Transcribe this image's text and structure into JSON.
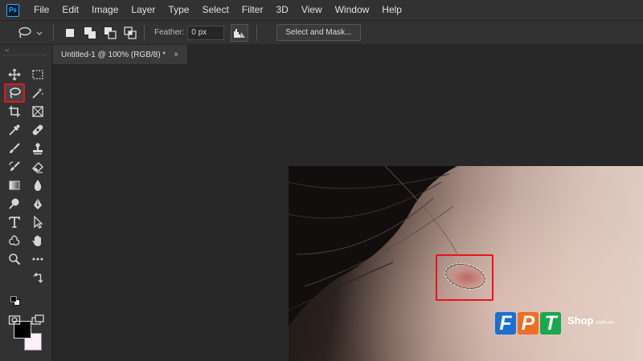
{
  "app": {
    "logo_text": "Ps",
    "accent": "#31a8ff"
  },
  "menu": [
    "File",
    "Edit",
    "Image",
    "Layer",
    "Type",
    "Select",
    "Filter",
    "3D",
    "View",
    "Window",
    "Help"
  ],
  "options": {
    "lasso_icon": "lasso-icon",
    "dropdown_icon": "chevron-down-icon",
    "modes": [
      "new-selection",
      "add-to-selection",
      "subtract-from-selection",
      "intersect-with-selection"
    ],
    "feather_label": "Feather:",
    "feather_value": "0 px",
    "antialias_icon": "anti-alias-icon",
    "select_mask_label": "Select and Mask..."
  },
  "document": {
    "tab_title": "Untitled-1 @ 100% (RGB/8) *",
    "close_glyph": "×"
  },
  "toolbar": {
    "collapse_glyph": "‹‹",
    "selected_tool": "lasso",
    "highlight_color": "#e8141c",
    "foreground_color": "#000000",
    "background_color": "#fdf0f8"
  },
  "watermark": {
    "letters": [
      "F",
      "P",
      "T"
    ],
    "letter_colors": [
      "#1a6fd4",
      "#f26c21",
      "#1aa84f"
    ],
    "shop": "Shop",
    "domain": ".com.vn"
  }
}
